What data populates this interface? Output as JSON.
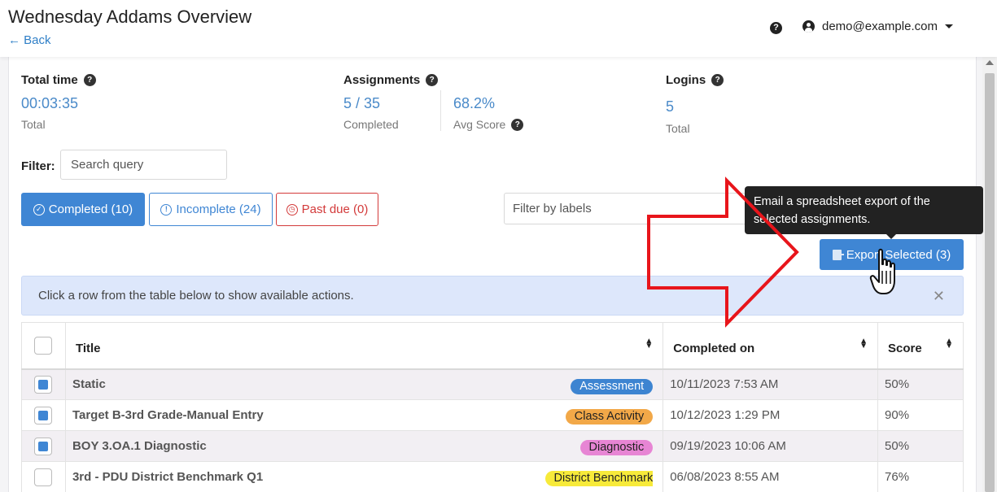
{
  "header": {
    "title": "Wednesday Addams Overview",
    "back_label": "← Back",
    "help_icon": "question-circle-icon",
    "user_email": "demo@example.com"
  },
  "stats": {
    "total_time": {
      "label": "Total time",
      "value": "00:03:35",
      "sub": "Total"
    },
    "assignments": {
      "label": "Assignments",
      "value": "5 / 35",
      "sub": "Completed",
      "avg_value": "68.2%",
      "avg_label": "Avg Score"
    },
    "logins": {
      "label": "Logins",
      "value": "5",
      "sub": "Total"
    }
  },
  "filter": {
    "label": "Filter:",
    "placeholder": "Search query",
    "labels_placeholder": "Filter by labels"
  },
  "status_buttons": {
    "completed": "Completed (10)",
    "incomplete": "Incomplete (24)",
    "past_due": "Past due (0)"
  },
  "tooltip": "Email a spreadsheet export of the selected assignments.",
  "export_label": "Export Selected (3)",
  "info_alert": "Click a row from the table below to show available actions.",
  "table": {
    "columns": [
      "Title",
      "Completed on",
      "Score"
    ],
    "rows": [
      {
        "selected": true,
        "title": "Static",
        "tag": "Assessment",
        "date": "10/11/2023 7:53 AM",
        "score": "50%"
      },
      {
        "selected": true,
        "title": "Target B-3rd Grade-Manual Entry",
        "tag": "Class Activity",
        "date": "10/12/2023 1:29 PM",
        "score": "90%"
      },
      {
        "selected": true,
        "title": "BOY 3.OA.1 Diagnostic",
        "tag": "Diagnostic",
        "date": "09/19/2023 10:06 AM",
        "score": "50%"
      },
      {
        "selected": false,
        "title": "3rd - PDU District Benchmark Q1",
        "tag": "District Benchmark",
        "date": "06/08/2023 8:55 AM",
        "score": "76%"
      }
    ]
  },
  "colors": {
    "primary": "#3f86d4",
    "danger": "#d33a3a",
    "tag_assessment": "#3d84d1",
    "tag_class_activity": "#f2a848",
    "tag_diagnostic": "#e785d4",
    "tag_district_benchmark": "#f7ea3a",
    "annotation_arrow": "#e8151b"
  }
}
